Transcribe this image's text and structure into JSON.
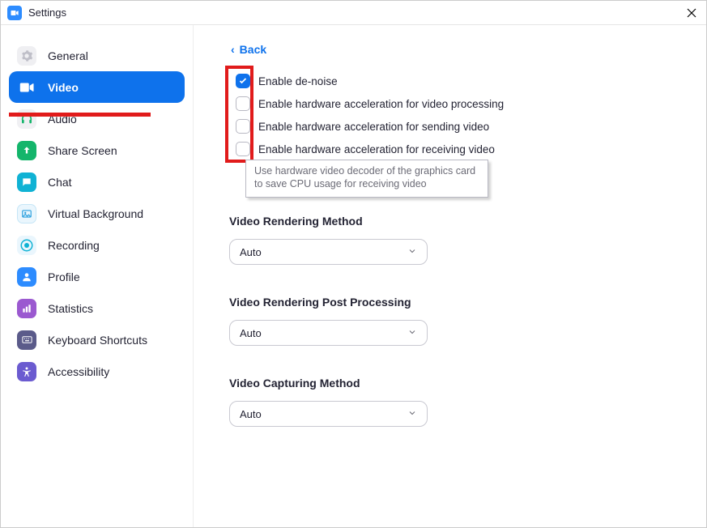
{
  "window": {
    "title": "Settings"
  },
  "sidebar": {
    "items": [
      {
        "label": "General"
      },
      {
        "label": "Video"
      },
      {
        "label": "Audio"
      },
      {
        "label": "Share Screen"
      },
      {
        "label": "Chat"
      },
      {
        "label": "Virtual Background"
      },
      {
        "label": "Recording"
      },
      {
        "label": "Profile"
      },
      {
        "label": "Statistics"
      },
      {
        "label": "Keyboard Shortcuts"
      },
      {
        "label": "Accessibility"
      }
    ],
    "active_index": 1
  },
  "main": {
    "back_label": "Back",
    "checks": [
      {
        "label": "Enable de-noise",
        "checked": true
      },
      {
        "label": "Enable hardware acceleration for video processing",
        "checked": false
      },
      {
        "label": "Enable hardware acceleration for sending video",
        "checked": false
      },
      {
        "label": "Enable hardware acceleration for receiving video",
        "checked": false
      }
    ],
    "tooltip": "Use hardware video decoder of the graphics card to save CPU usage for receiving video",
    "sections": [
      {
        "title": "Video Rendering Method",
        "value": "Auto"
      },
      {
        "title": "Video Rendering Post Processing",
        "value": "Auto"
      },
      {
        "title": "Video Capturing Method",
        "value": "Auto"
      }
    ]
  },
  "colors": {
    "accent": "#0e72ec",
    "annotation": "#e11b1b"
  }
}
